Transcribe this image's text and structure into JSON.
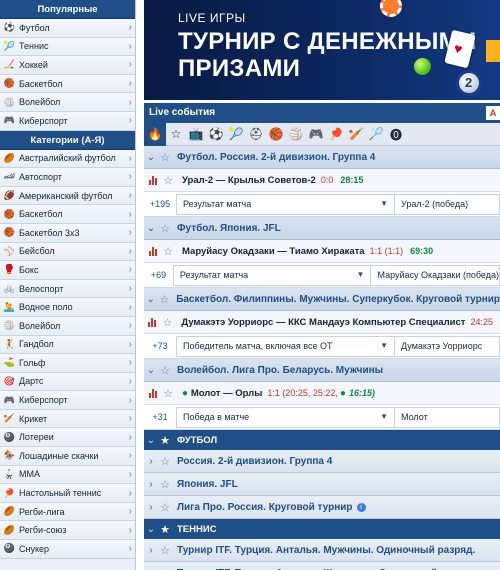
{
  "sidebar": {
    "popular_title": "Популярные",
    "popular": [
      {
        "label": "Футбол",
        "icon": "⚽"
      },
      {
        "label": "Теннис",
        "icon": "🎾"
      },
      {
        "label": "Хоккей",
        "icon": "🏒"
      },
      {
        "label": "Баскетбол",
        "icon": "🏀"
      },
      {
        "label": "Волейбол",
        "icon": "🏐"
      },
      {
        "label": "Киберспорт",
        "icon": "🎮"
      }
    ],
    "categories_title": "Категории (А-Я)",
    "categories": [
      {
        "label": "Австралийский футбол",
        "icon": "🏉"
      },
      {
        "label": "Автоспорт",
        "icon": "🏎"
      },
      {
        "label": "Американский футбол",
        "icon": "🏈"
      },
      {
        "label": "Баскетбол",
        "icon": "🏀"
      },
      {
        "label": "Баскетбол 3x3",
        "icon": "🏀"
      },
      {
        "label": "Бейсбол",
        "icon": "⚾"
      },
      {
        "label": "Бокс",
        "icon": "🥊"
      },
      {
        "label": "Велоспорт",
        "icon": "🚲"
      },
      {
        "label": "Водное поло",
        "icon": "🤽"
      },
      {
        "label": "Волейбол",
        "icon": "🏐"
      },
      {
        "label": "Гандбол",
        "icon": "🤾"
      },
      {
        "label": "Гольф",
        "icon": "⛳"
      },
      {
        "label": "Дартс",
        "icon": "🎯"
      },
      {
        "label": "Киберспорт",
        "icon": "🎮"
      },
      {
        "label": "Крикет",
        "icon": "🏏"
      },
      {
        "label": "Лотереи",
        "icon": "🎱"
      },
      {
        "label": "Лошадиные скачки",
        "icon": "🏇"
      },
      {
        "label": "ММА",
        "icon": "🥋"
      },
      {
        "label": "Настольный теннис",
        "icon": "🏓"
      },
      {
        "label": "Регби-лига",
        "icon": "🏉"
      },
      {
        "label": "Регби-союз",
        "icon": "🏉"
      },
      {
        "label": "Снукер",
        "icon": "🎱"
      }
    ]
  },
  "banner": {
    "subtitle": "LIVE ИГРЫ",
    "title": "ТУРНИР С ДЕНЕЖНЫМИ ПРИЗАМИ",
    "ball_number": "2"
  },
  "live": {
    "title": "Live события",
    "corner_icon": "A"
  },
  "events": [
    {
      "group": "Футбол. Россия. 2-й дивизион. Группа 4",
      "teams": "Урал-2 — Крылья Советов-2",
      "score": "0:0",
      "time": "28:15",
      "count": "+195",
      "market": "Результат матча",
      "selection": "Урал-2 (победа)"
    },
    {
      "group": "Футбол. Япония. JFL",
      "teams": "Маруйасу Окадзаки — Тиамо Хираката",
      "score": "1:1 (1:1)",
      "time": "69:30",
      "count": "+69",
      "market": "Результат матча",
      "selection": "Маруйасу Окадзаки (победа)"
    },
    {
      "group": "Баскетбол. Филиппины. Мужчины. Суперкубок. Круговой турнир",
      "teams": "Думакэтэ Уорриорс — ККС Мандауэ Компьютер Специалист",
      "score": "24:25",
      "time": "",
      "count": "+73",
      "market": "Победитель матча, включая все ОТ",
      "selection": "Думакэтэ Уорриорс"
    },
    {
      "group": "Волейбол. Лига Про. Беларусь. Мужчины",
      "teams": "Молот — Орлы",
      "score": "1:1 (20:25, 25:22,",
      "time": "16:15)",
      "count": "+31",
      "market": "Победа в матче",
      "selection": "Молот"
    }
  ],
  "sections": [
    {
      "title": "ФУТБОЛ",
      "items": [
        "Россия. 2-й дивизион. Группа 4",
        "Япония. JFL",
        "Лига Про. Россия. Круговой турнир"
      ]
    },
    {
      "title": "ТЕННИС",
      "items": [
        "Турнир ITF. Турция. Анталья. Мужчины. Одиночный разряд.",
        "Турнир ITF. Турция. Анталья. Женщины. Одиночный разряд."
      ]
    }
  ],
  "colors": {
    "header_blue": "#1f4f86",
    "live_time_green": "#0f8a3e",
    "score_red": "#c0392b"
  }
}
